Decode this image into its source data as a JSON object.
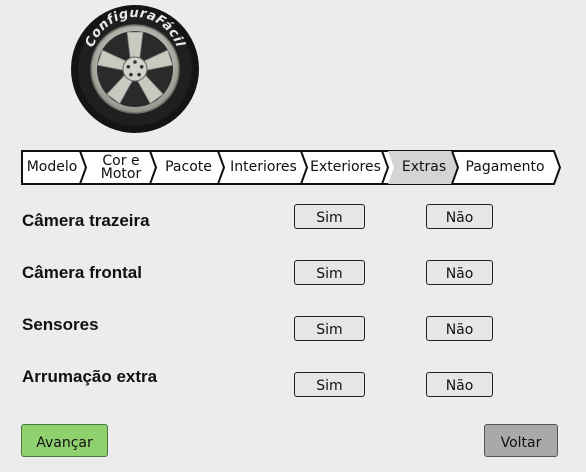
{
  "brand": {
    "logo_text": "ConfiguraFácil",
    "logo_icon": "tire-icon"
  },
  "steps": [
    {
      "label": "Modelo"
    },
    {
      "label": "Cor e Motor"
    },
    {
      "label": "Pacote"
    },
    {
      "label": "Interiores"
    },
    {
      "label": "Exteriores"
    },
    {
      "label": "Extras"
    },
    {
      "label": "Pagamento"
    }
  ],
  "active_step": "Extras",
  "options": [
    {
      "label": "Câmera trazeira",
      "yes": "Sim",
      "no": "Não"
    },
    {
      "label": "Câmera frontal",
      "yes": "Sim",
      "no": "Não"
    },
    {
      "label": "Sensores",
      "yes": "Sim",
      "no": "Não"
    },
    {
      "label": "Arrumação extra",
      "yes": "Sim",
      "no": "Não"
    }
  ],
  "actions": {
    "advance": "Avançar",
    "back": "Voltar"
  },
  "colors": {
    "background": "#ececec",
    "advance_button": "#8fd16f",
    "back_button": "#a9a9a9",
    "active_step_fill": "#d4d4d4"
  }
}
